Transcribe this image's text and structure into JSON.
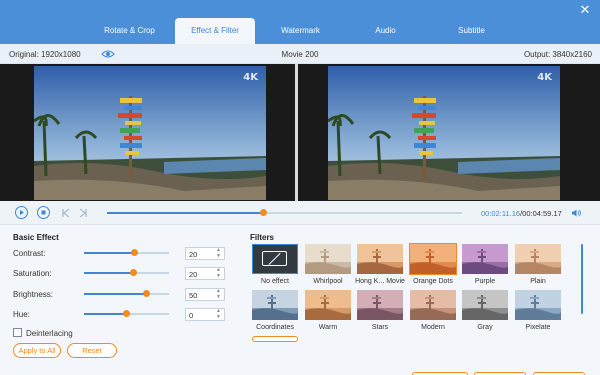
{
  "tabs": [
    {
      "label": "Rotate & Crop",
      "active": false
    },
    {
      "label": "Effect & Filter",
      "active": true
    },
    {
      "label": "Watermark",
      "active": false
    },
    {
      "label": "Audio",
      "active": false
    },
    {
      "label": "Subtitle",
      "active": false
    }
  ],
  "info": {
    "original": "Original: 1920x1080",
    "title": "Movie 200",
    "output": "Output: 3840x2160"
  },
  "preview": {
    "badge_left": "4K",
    "badge_right": "4K"
  },
  "playback": {
    "current": "00:02:11.16",
    "total": "/00:04:59.17",
    "progress": 0.44
  },
  "basic_effect": {
    "title": "Basic Effect",
    "rows": [
      {
        "label": "Contrast:",
        "value": "20",
        "level": 0.59
      },
      {
        "label": "Saturation:",
        "value": "20",
        "level": 0.58
      },
      {
        "label": "Brightness:",
        "value": "50",
        "level": 0.73
      },
      {
        "label": "Hue:",
        "value": "0",
        "level": 0.49
      }
    ],
    "deinterlacing": "Deinterlacing",
    "apply_all": "Apply to All",
    "reset": "Reset"
  },
  "filters": {
    "title": "Filters",
    "items": [
      {
        "label": "No effect",
        "style": "none"
      },
      {
        "label": "Whirlpool",
        "style": "whirlpool"
      },
      {
        "label": "Hong K... Movie",
        "style": "hongkong"
      },
      {
        "label": "Orange Dots",
        "style": "orangedots"
      },
      {
        "label": "Purple",
        "style": "purple"
      },
      {
        "label": "Plain",
        "style": "plain"
      },
      {
        "label": "Coordinates",
        "style": "coordinates"
      },
      {
        "label": "Warm",
        "style": "warm"
      },
      {
        "label": "Stars",
        "style": "stars"
      },
      {
        "label": "Modern",
        "style": "modern"
      },
      {
        "label": "Gray",
        "style": "gray"
      },
      {
        "label": "Pixelate",
        "style": "pixelate"
      }
    ]
  },
  "colors": {
    "accent": "#3f86d6",
    "orange": "#f08a24",
    "topbar": "#4b8fd9"
  }
}
